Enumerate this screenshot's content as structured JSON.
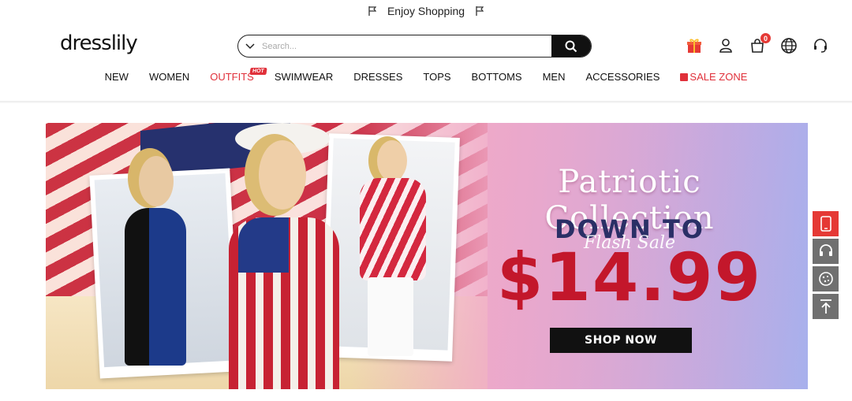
{
  "topbar": {
    "message": "Enjoy Shopping",
    "icons": [
      "flag-icon",
      "flag-icon"
    ]
  },
  "header": {
    "logo": "dresslily",
    "search": {
      "placeholder": "Search..."
    },
    "icons": [
      "gift-icon",
      "user-icon",
      "cart-icon",
      "globe-icon",
      "headset-icon"
    ],
    "cart_count": "0"
  },
  "nav": {
    "items": [
      {
        "label": "NEW"
      },
      {
        "label": "WOMEN"
      },
      {
        "label": "OUTFITS",
        "badge": "HOT"
      },
      {
        "label": "SWIMWEAR"
      },
      {
        "label": "DRESSES"
      },
      {
        "label": "TOPS"
      },
      {
        "label": "BOTTOMS"
      },
      {
        "label": "MEN"
      },
      {
        "label": "ACCESSORIES"
      },
      {
        "label": "SALE ZONE"
      }
    ]
  },
  "banner": {
    "headline": "Patriotic Collection",
    "down_to": "DOWN TO",
    "script": "Flash Sale",
    "price": "$14.99",
    "cta": "SHOP NOW"
  },
  "side_tools": [
    "phone-icon",
    "headset-icon",
    "cookie-icon",
    "back-to-top-icon"
  ],
  "colors": {
    "accent": "#e0303a",
    "price": "#c3172b",
    "dark": "#111111",
    "sidebar": "#707070"
  }
}
